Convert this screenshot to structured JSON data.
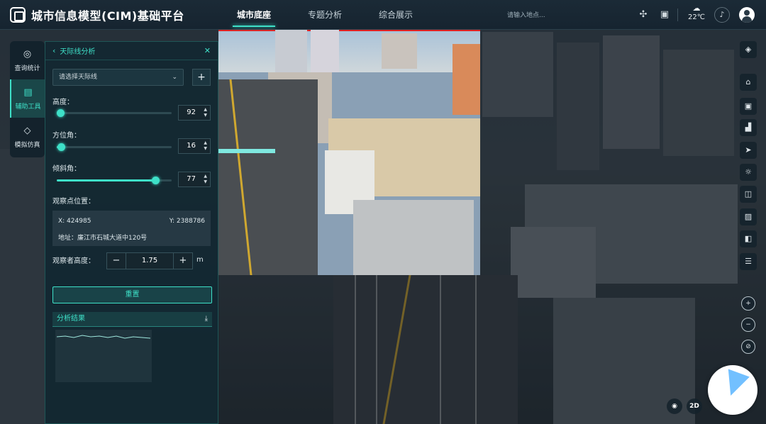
{
  "header": {
    "title": "城市信息模型(CIM)基础平台",
    "tabs": [
      {
        "label": "城市底座",
        "active": true
      },
      {
        "label": "专题分析",
        "active": false
      },
      {
        "label": "综合展示",
        "active": false
      }
    ],
    "search_placeholder": "请输入地点...",
    "weather_temp": "22℃",
    "accent": "#3ee0c8"
  },
  "left_nav": [
    {
      "label": "查询统计",
      "icon": "chart-search-icon"
    },
    {
      "label": "辅助工具",
      "icon": "toolbox-icon",
      "active": true
    },
    {
      "label": "模拟仿真",
      "icon": "cube-icon"
    }
  ],
  "panel": {
    "title": "天际线分析",
    "select_placeholder": "请选择天际线",
    "height": {
      "label": "高度：",
      "value": "92",
      "level": 0.03
    },
    "azimuth": {
      "label": "方位角：",
      "value": "16",
      "level": 0.04
    },
    "tilt": {
      "label": "倾斜角：",
      "value": "77",
      "level": 0.86
    },
    "observer_label": "观察点位置：",
    "x": "X:   424985",
    "y": "Y:   2388786",
    "address": "地址：廉江市石城大道中120号",
    "observer_height_label": "观察者高度：",
    "observer_height": "1.75",
    "minus": "−",
    "plus": "+",
    "unit": "m",
    "reset": "重置",
    "result_title": "分析结果"
  },
  "map": {
    "mode_2d": "2D"
  }
}
